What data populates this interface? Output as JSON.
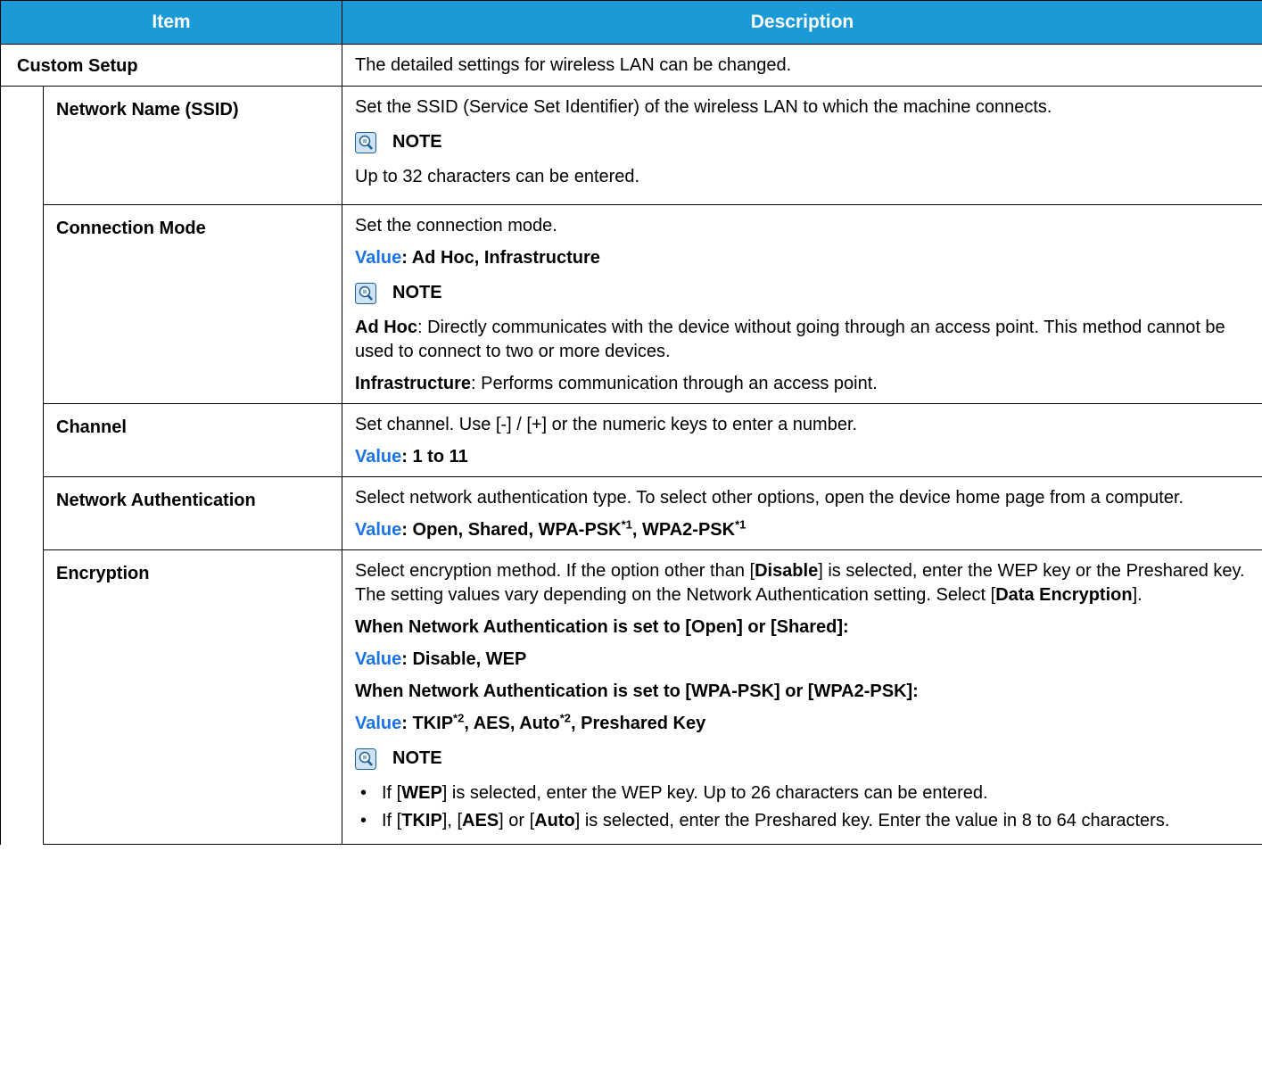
{
  "header": {
    "item": "Item",
    "description": "Description"
  },
  "custom_setup": {
    "label": "Custom Setup",
    "description": "The detailed settings for wireless LAN can be changed."
  },
  "ssid": {
    "label": "Network Name (SSID)",
    "description": "Set the SSID (Service Set Identifier) of the wireless LAN to which the machine connects.",
    "note_label": "NOTE",
    "note_text": "Up to 32 characters can be entered."
  },
  "connection_mode": {
    "label": "Connection Mode",
    "description": "Set the connection mode.",
    "value_label": "Value",
    "value_text": ": Ad Hoc, Infrastructure",
    "note_label": "NOTE",
    "adhoc_term": "Ad Hoc",
    "adhoc_text": ": Directly communicates with the device without going through an access point. This method cannot be used to connect to two or more devices.",
    "infra_term": "Infrastructure",
    "infra_text": ": Performs communication through an access point."
  },
  "channel": {
    "label": "Channel",
    "description": "Set channel. Use [-] / [+] or the numeric keys to enter a number.",
    "value_label": "Value",
    "value_text": ": 1 to 11"
  },
  "network_auth": {
    "label": "Network Authentication",
    "description": "Select network authentication type. To select other options, open the device home page from a computer.",
    "value_label": "Value",
    "value_text_1": ": Open, Shared, WPA-PSK",
    "sup_1": "*1",
    "value_text_2": ", WPA2-PSK",
    "sup_2": "*1"
  },
  "encryption": {
    "label": "Encryption",
    "desc_1": "Select encryption method. If the option other than [",
    "desc_disable": "Disable",
    "desc_2": "] is selected, enter the WEP key or the Preshared key. The setting values vary depending on the Network Authentication setting. Select [",
    "desc_data_enc": "Data Encryption",
    "desc_3": "].",
    "cond_1": "When Network Authentication is set to [Open] or [Shared]:",
    "value_label": "Value",
    "value_1": ": Disable, WEP",
    "cond_2": "When Network Authentication is set to [WPA-PSK] or [WPA2-PSK]:",
    "value_2a": ": TKIP",
    "sup_a": "*2",
    "value_2b": ", AES, Auto",
    "sup_b": "*2",
    "value_2c": ", Preshared Key",
    "note_label": "NOTE",
    "b1_pre": "If [",
    "b1_wep": "WEP",
    "b1_post": "] is selected, enter the WEP key. Up to 26 characters can be entered.",
    "b2_pre": "If [",
    "b2_tkip": "TKIP",
    "b2_mid1": "], [",
    "b2_aes": "AES",
    "b2_mid2": "] or [",
    "b2_auto": "Auto",
    "b2_post": "] is selected, enter the Preshared key. Enter the value in 8 to 64 characters."
  },
  "icons": {
    "note": "note-lightbulb-icon",
    "accent": "#1a9ad6",
    "value_color": "#1a73e8"
  }
}
